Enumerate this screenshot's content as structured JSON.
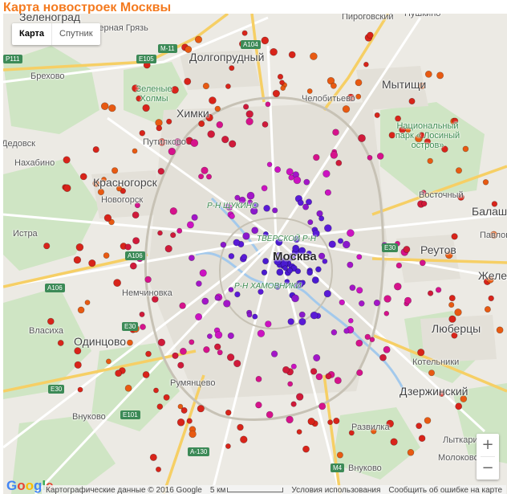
{
  "title": "Карта новостроек Москвы",
  "map_type": {
    "map_label": "Карта",
    "satellite_label": "Спутник",
    "selected": "Карта"
  },
  "zoom": {
    "in_label": "+",
    "out_label": "−"
  },
  "logo": "Google",
  "footer": {
    "data_label": "Картографические данные © 2016 Google",
    "scale_label": "5 км",
    "terms_label": "Условия использования",
    "report_label": "Сообщить об ошибке на карте"
  },
  "places": [
    {
      "name": "Зеленоград",
      "style": "big"
    },
    {
      "name": "Черная Грязь",
      "style": "small"
    },
    {
      "name": "Пироговский",
      "style": "small"
    },
    {
      "name": "Пушкино",
      "style": "small"
    },
    {
      "name": "Долгопрудный",
      "style": "big"
    },
    {
      "name": "Брехово",
      "style": "small"
    },
    {
      "name": "Мытищи",
      "style": "big"
    },
    {
      "name": "Зеленые Холмы",
      "style": "green"
    },
    {
      "name": "Химки",
      "style": "big"
    },
    {
      "name": "Челобитьево",
      "style": "small"
    },
    {
      "name": "Национальный парк « Лосиный остров»",
      "style": "green"
    },
    {
      "name": "Дедовск",
      "style": "small"
    },
    {
      "name": "Путилково",
      "style": "small"
    },
    {
      "name": "Нахабино",
      "style": "small"
    },
    {
      "name": "Красногорск",
      "style": "big"
    },
    {
      "name": "Новогорск",
      "style": "small"
    },
    {
      "name": "Восточный",
      "style": "small"
    },
    {
      "name": "Балашиха",
      "style": "big"
    },
    {
      "name": "Павловская Слобода",
      "style": "small"
    },
    {
      "name": "Р-Н ЩУКИНО",
      "style": "greenit"
    },
    {
      "name": "Истра",
      "style": "small"
    },
    {
      "name": "ТВЕРСКОЙ Р-Н",
      "style": "greenit"
    },
    {
      "name": "Москва",
      "style": "center"
    },
    {
      "name": "Реутов",
      "style": "big"
    },
    {
      "name": "Внуково",
      "style": "small"
    },
    {
      "name": "Железнодорожный",
      "style": "big"
    },
    {
      "name": "Немчиновка",
      "style": "small"
    },
    {
      "name": "Р-Н ХАМОВНИКИ",
      "style": "greenit"
    },
    {
      "name": "Власиха",
      "style": "small"
    },
    {
      "name": "Люберцы",
      "style": "big"
    },
    {
      "name": "Одинцово",
      "style": "big"
    },
    {
      "name": "Котельники",
      "style": "small"
    },
    {
      "name": "Румянцево",
      "style": "small"
    },
    {
      "name": "Дзержинский",
      "style": "big"
    },
    {
      "name": "Внуково",
      "style": "small"
    },
    {
      "name": "Развилка",
      "style": "small"
    },
    {
      "name": "Лыткарино",
      "style": "small"
    },
    {
      "name": "Молоково",
      "style": "small"
    }
  ],
  "road_shields": [
    "M-11",
    "A104",
    "E105",
    "P111",
    "A106",
    "A106",
    "E30",
    "E30",
    "E101",
    "A-130",
    "M4",
    "E30"
  ]
}
